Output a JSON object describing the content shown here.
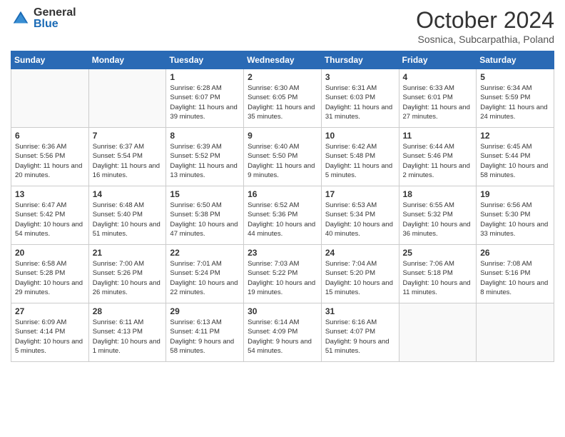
{
  "header": {
    "logo_general": "General",
    "logo_blue": "Blue",
    "month_title": "October 2024",
    "location": "Sosnica, Subcarpathia, Poland"
  },
  "weekdays": [
    "Sunday",
    "Monday",
    "Tuesday",
    "Wednesday",
    "Thursday",
    "Friday",
    "Saturday"
  ],
  "weeks": [
    [
      {
        "day": "",
        "sunrise": "",
        "sunset": "",
        "daylight": ""
      },
      {
        "day": "",
        "sunrise": "",
        "sunset": "",
        "daylight": ""
      },
      {
        "day": "1",
        "sunrise": "Sunrise: 6:28 AM",
        "sunset": "Sunset: 6:07 PM",
        "daylight": "Daylight: 11 hours and 39 minutes."
      },
      {
        "day": "2",
        "sunrise": "Sunrise: 6:30 AM",
        "sunset": "Sunset: 6:05 PM",
        "daylight": "Daylight: 11 hours and 35 minutes."
      },
      {
        "day": "3",
        "sunrise": "Sunrise: 6:31 AM",
        "sunset": "Sunset: 6:03 PM",
        "daylight": "Daylight: 11 hours and 31 minutes."
      },
      {
        "day": "4",
        "sunrise": "Sunrise: 6:33 AM",
        "sunset": "Sunset: 6:01 PM",
        "daylight": "Daylight: 11 hours and 27 minutes."
      },
      {
        "day": "5",
        "sunrise": "Sunrise: 6:34 AM",
        "sunset": "Sunset: 5:59 PM",
        "daylight": "Daylight: 11 hours and 24 minutes."
      }
    ],
    [
      {
        "day": "6",
        "sunrise": "Sunrise: 6:36 AM",
        "sunset": "Sunset: 5:56 PM",
        "daylight": "Daylight: 11 hours and 20 minutes."
      },
      {
        "day": "7",
        "sunrise": "Sunrise: 6:37 AM",
        "sunset": "Sunset: 5:54 PM",
        "daylight": "Daylight: 11 hours and 16 minutes."
      },
      {
        "day": "8",
        "sunrise": "Sunrise: 6:39 AM",
        "sunset": "Sunset: 5:52 PM",
        "daylight": "Daylight: 11 hours and 13 minutes."
      },
      {
        "day": "9",
        "sunrise": "Sunrise: 6:40 AM",
        "sunset": "Sunset: 5:50 PM",
        "daylight": "Daylight: 11 hours and 9 minutes."
      },
      {
        "day": "10",
        "sunrise": "Sunrise: 6:42 AM",
        "sunset": "Sunset: 5:48 PM",
        "daylight": "Daylight: 11 hours and 5 minutes."
      },
      {
        "day": "11",
        "sunrise": "Sunrise: 6:44 AM",
        "sunset": "Sunset: 5:46 PM",
        "daylight": "Daylight: 11 hours and 2 minutes."
      },
      {
        "day": "12",
        "sunrise": "Sunrise: 6:45 AM",
        "sunset": "Sunset: 5:44 PM",
        "daylight": "Daylight: 10 hours and 58 minutes."
      }
    ],
    [
      {
        "day": "13",
        "sunrise": "Sunrise: 6:47 AM",
        "sunset": "Sunset: 5:42 PM",
        "daylight": "Daylight: 10 hours and 54 minutes."
      },
      {
        "day": "14",
        "sunrise": "Sunrise: 6:48 AM",
        "sunset": "Sunset: 5:40 PM",
        "daylight": "Daylight: 10 hours and 51 minutes."
      },
      {
        "day": "15",
        "sunrise": "Sunrise: 6:50 AM",
        "sunset": "Sunset: 5:38 PM",
        "daylight": "Daylight: 10 hours and 47 minutes."
      },
      {
        "day": "16",
        "sunrise": "Sunrise: 6:52 AM",
        "sunset": "Sunset: 5:36 PM",
        "daylight": "Daylight: 10 hours and 44 minutes."
      },
      {
        "day": "17",
        "sunrise": "Sunrise: 6:53 AM",
        "sunset": "Sunset: 5:34 PM",
        "daylight": "Daylight: 10 hours and 40 minutes."
      },
      {
        "day": "18",
        "sunrise": "Sunrise: 6:55 AM",
        "sunset": "Sunset: 5:32 PM",
        "daylight": "Daylight: 10 hours and 36 minutes."
      },
      {
        "day": "19",
        "sunrise": "Sunrise: 6:56 AM",
        "sunset": "Sunset: 5:30 PM",
        "daylight": "Daylight: 10 hours and 33 minutes."
      }
    ],
    [
      {
        "day": "20",
        "sunrise": "Sunrise: 6:58 AM",
        "sunset": "Sunset: 5:28 PM",
        "daylight": "Daylight: 10 hours and 29 minutes."
      },
      {
        "day": "21",
        "sunrise": "Sunrise: 7:00 AM",
        "sunset": "Sunset: 5:26 PM",
        "daylight": "Daylight: 10 hours and 26 minutes."
      },
      {
        "day": "22",
        "sunrise": "Sunrise: 7:01 AM",
        "sunset": "Sunset: 5:24 PM",
        "daylight": "Daylight: 10 hours and 22 minutes."
      },
      {
        "day": "23",
        "sunrise": "Sunrise: 7:03 AM",
        "sunset": "Sunset: 5:22 PM",
        "daylight": "Daylight: 10 hours and 19 minutes."
      },
      {
        "day": "24",
        "sunrise": "Sunrise: 7:04 AM",
        "sunset": "Sunset: 5:20 PM",
        "daylight": "Daylight: 10 hours and 15 minutes."
      },
      {
        "day": "25",
        "sunrise": "Sunrise: 7:06 AM",
        "sunset": "Sunset: 5:18 PM",
        "daylight": "Daylight: 10 hours and 11 minutes."
      },
      {
        "day": "26",
        "sunrise": "Sunrise: 7:08 AM",
        "sunset": "Sunset: 5:16 PM",
        "daylight": "Daylight: 10 hours and 8 minutes."
      }
    ],
    [
      {
        "day": "27",
        "sunrise": "Sunrise: 6:09 AM",
        "sunset": "Sunset: 4:14 PM",
        "daylight": "Daylight: 10 hours and 5 minutes."
      },
      {
        "day": "28",
        "sunrise": "Sunrise: 6:11 AM",
        "sunset": "Sunset: 4:13 PM",
        "daylight": "Daylight: 10 hours and 1 minute."
      },
      {
        "day": "29",
        "sunrise": "Sunrise: 6:13 AM",
        "sunset": "Sunset: 4:11 PM",
        "daylight": "Daylight: 9 hours and 58 minutes."
      },
      {
        "day": "30",
        "sunrise": "Sunrise: 6:14 AM",
        "sunset": "Sunset: 4:09 PM",
        "daylight": "Daylight: 9 hours and 54 minutes."
      },
      {
        "day": "31",
        "sunrise": "Sunrise: 6:16 AM",
        "sunset": "Sunset: 4:07 PM",
        "daylight": "Daylight: 9 hours and 51 minutes."
      },
      {
        "day": "",
        "sunrise": "",
        "sunset": "",
        "daylight": ""
      },
      {
        "day": "",
        "sunrise": "",
        "sunset": "",
        "daylight": ""
      }
    ]
  ]
}
